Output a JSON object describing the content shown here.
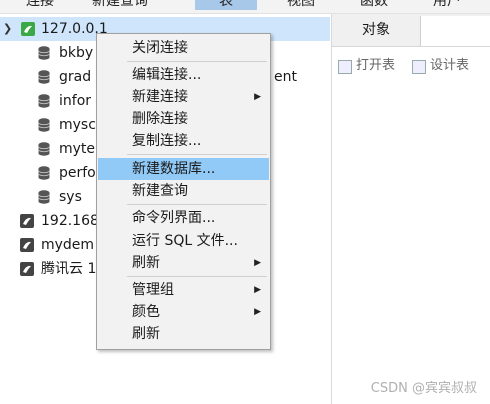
{
  "toolbar": {
    "items": [
      "连接",
      "新建查询",
      "表",
      "视图",
      "函数",
      "用户"
    ]
  },
  "tree": {
    "root_label": "127.0.0.1",
    "databases": [
      "bkby",
      "grad",
      "infor",
      "mysc",
      "myte",
      "perfo",
      "sys"
    ],
    "other_connections": [
      "192.168",
      "mydem",
      "腾讯云 1"
    ],
    "partial_text": "ent"
  },
  "right": {
    "tab_label": "对象",
    "open_table": "打开表",
    "design_table": "设计表"
  },
  "menu": {
    "items": [
      {
        "label": "关闭连接",
        "submenu": false
      },
      {
        "label": "编辑连接...",
        "submenu": false
      },
      {
        "label": "新建连接",
        "submenu": true
      },
      {
        "label": "删除连接",
        "submenu": false
      },
      {
        "label": "复制连接...",
        "submenu": false
      },
      {
        "label": "新建数据库...",
        "submenu": false,
        "highlighted": true
      },
      {
        "label": "新建查询",
        "submenu": false
      },
      {
        "label": "命令列界面...",
        "submenu": false
      },
      {
        "label": "运行 SQL 文件...",
        "submenu": false
      },
      {
        "label": "刷新",
        "submenu": true
      },
      {
        "label": "管理组",
        "submenu": true
      },
      {
        "label": "颜色",
        "submenu": true
      },
      {
        "label": "刷新",
        "submenu": false
      }
    ]
  },
  "watermark": "CSDN @宾宾叔叔",
  "colors": {
    "highlight": "#91c9f7",
    "selected_row": "#cfe5fb",
    "connection_green": "#3aa845"
  }
}
